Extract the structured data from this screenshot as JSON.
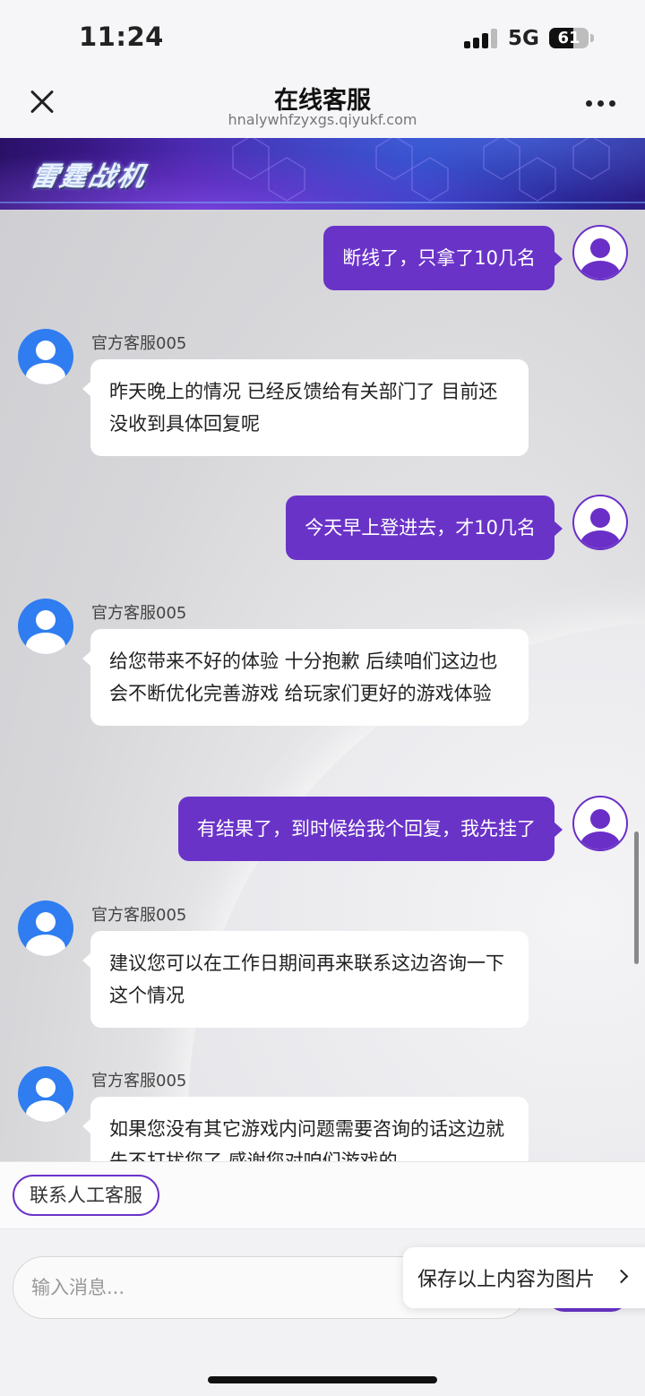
{
  "status_bar": {
    "time": "11:24",
    "network": "5G",
    "battery_level": "61",
    "battery_fraction": 0.61
  },
  "nav": {
    "title": "在线客服",
    "url": "hnalywhfzyxgs.qiyukf.com"
  },
  "banner": {
    "logo_text": "雷霆战机"
  },
  "messages": [
    {
      "from": "user",
      "text": "断线了，只拿了10几名"
    },
    {
      "from": "agent",
      "sender": "官方客服005",
      "text": "昨天晚上的情况 已经反馈给有关部门了 目前还没收到具体回复呢"
    },
    {
      "from": "user",
      "text": "今天早上登进去，才10几名"
    },
    {
      "from": "agent",
      "sender": "官方客服005",
      "text": "给您带来不好的体验 十分抱歉 后续咱们这边也会不断优化完善游戏 给玩家们更好的游戏体验"
    },
    {
      "from": "user",
      "text": "有结果了，到时候给我个回复，我先挂了"
    },
    {
      "from": "agent",
      "sender": "官方客服005",
      "text": "建议您可以在工作日期间再来联系这边咨询一下这个情况"
    },
    {
      "from": "agent",
      "sender": "官方客服005",
      "text": "如果您没有其它游戏内问题需要咨询的话这边就先不打扰您了 感谢您对咱们游戏的"
    }
  ],
  "quick_reply": {
    "label": "联系人工客服"
  },
  "input": {
    "placeholder": "输入消息..."
  },
  "save_popup": {
    "label": "保存以上内容为图片"
  },
  "colors": {
    "accent": "#6a33c8",
    "agent_avatar": "#2f7df0"
  }
}
